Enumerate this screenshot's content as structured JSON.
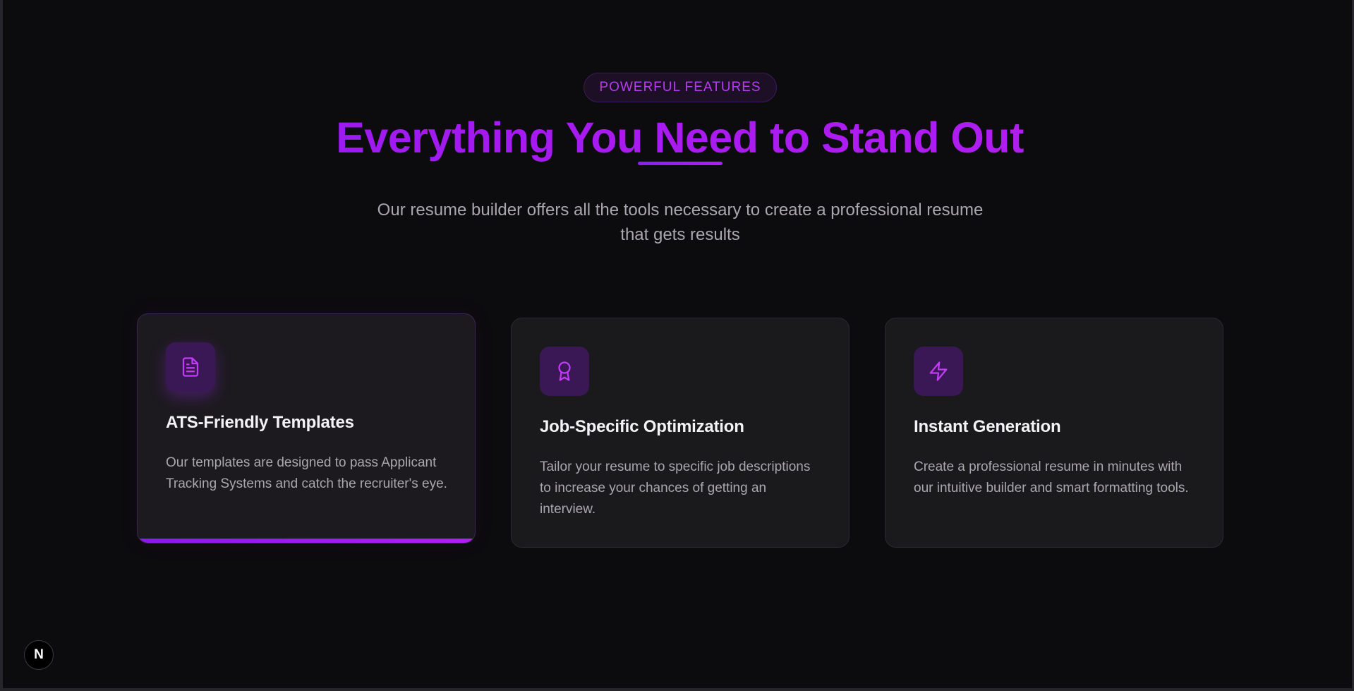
{
  "section": {
    "badge": "POWERFUL FEATURES",
    "headline": "Everything You Need to Stand Out",
    "subtitle": "Our resume builder offers all the tools necessary to create a professional resume that gets results"
  },
  "features": [
    {
      "title": "ATS-Friendly Templates",
      "description": "Our templates are designed to pass Applicant Tracking Systems and catch the recruiter's eye.",
      "icon": "document-icon",
      "active": true
    },
    {
      "title": "Job-Specific Optimization",
      "description": "Tailor your resume to specific job descriptions to increase your chances of getting an interview.",
      "icon": "award-icon",
      "active": false
    },
    {
      "title": "Instant Generation",
      "description": "Create a professional resume in minutes with our intuitive builder and smart formatting tools.",
      "icon": "lightning-icon",
      "active": false
    }
  ],
  "dev_badge": {
    "label": "N",
    "icon": "nextjs-logo-icon"
  },
  "colors": {
    "background": "#0c0b0d",
    "card_background": "#1a191c",
    "accent_purple": "#a61af0",
    "badge_text": "#b63cf0",
    "icon_box": "#3a1856",
    "body_text": "#aaa8ae",
    "title_text": "#f3f2f5"
  }
}
